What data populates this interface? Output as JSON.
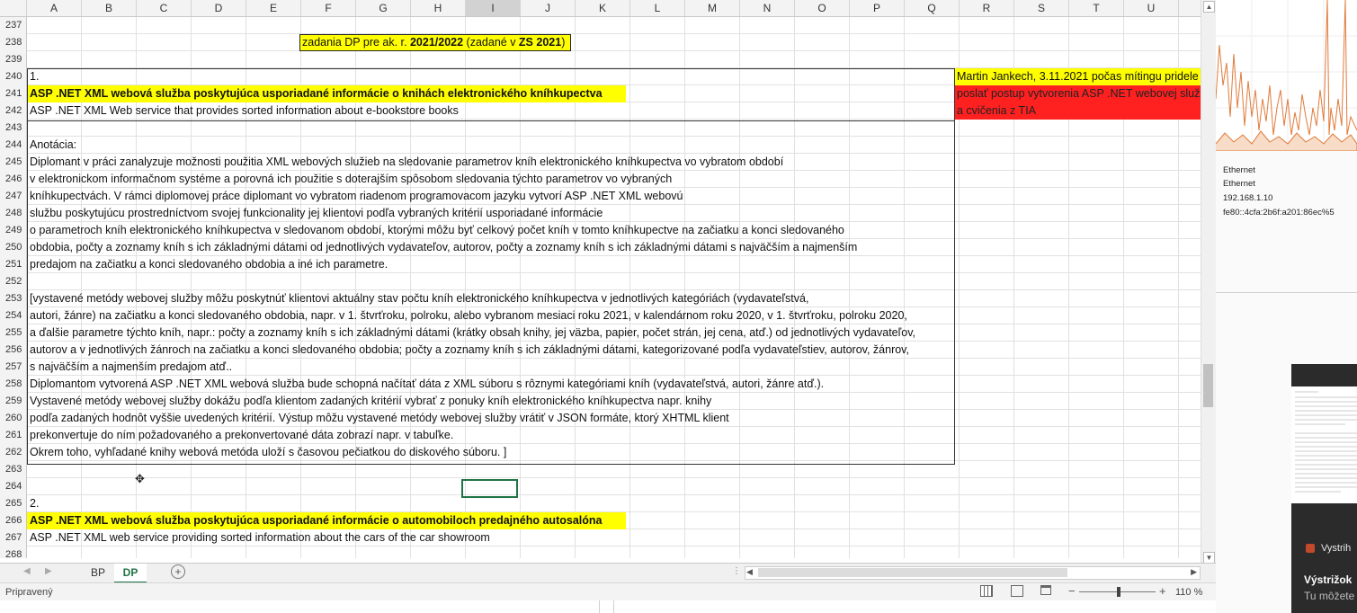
{
  "columns": [
    "A",
    "B",
    "C",
    "D",
    "E",
    "F",
    "G",
    "H",
    "I",
    "J",
    "K",
    "L",
    "M",
    "N",
    "O",
    "P",
    "Q",
    "R",
    "S",
    "T",
    "U"
  ],
  "rows": [
    {
      "num": "237",
      "text": "",
      "bold": false,
      "hl": false
    },
    {
      "num": "238",
      "text": "",
      "bold": false,
      "hl": false
    },
    {
      "num": "239",
      "text": "",
      "bold": false,
      "hl": false
    },
    {
      "num": "240",
      "text": "1.",
      "bold": false,
      "hl": false
    },
    {
      "num": "241",
      "text": "ASP .NET XML webová služba poskytujúca usporiadané informácie o knihách elektronického kníhkupectva",
      "bold": true,
      "hl": true
    },
    {
      "num": "242",
      "text": "ASP .NET XML Web service that provides sorted information about e-bookstore books",
      "bold": false,
      "hl": false
    },
    {
      "num": "243",
      "text": "",
      "bold": false,
      "hl": false
    },
    {
      "num": "244",
      "text": "Anotácia:",
      "bold": false,
      "hl": false
    },
    {
      "num": "245",
      "text": "Diplomant v práci zanalyzuje možnosti použitia XML webových služieb na sledovanie parametrov kníh elektronického kníhkupectva vo vybratom období",
      "bold": false,
      "hl": false
    },
    {
      "num": "246",
      "text": "v elektronickom informačnom systéme a porovná ich použitie s doterajším spôsobom sledovania týchto parametrov vo vybraných",
      "bold": false,
      "hl": false
    },
    {
      "num": "247",
      "text": "kníhkupectvách. V rámci diplomovej práce diplomant vo vybratom riadenom programovacom jazyku vytvorí ASP .NET XML webovú",
      "bold": false,
      "hl": false
    },
    {
      "num": "248",
      "text": "službu poskytujúcu prostredníctvom svojej funkcionality jej klientovi podľa vybraných kritérií usporiadané informácie",
      "bold": false,
      "hl": false
    },
    {
      "num": "249",
      "text": "o parametroch kníh elektronického kníhkupectva v sledovanom období, ktorými môžu byť celkový počet kníh v tomto kníhkupectve na začiatku a konci sledovaného",
      "bold": false,
      "hl": false
    },
    {
      "num": "250",
      "text": "obdobia, počty a zoznamy kníh s ich základnými dátami od jednotlivých vydavateľov, autorov, počty a zoznamy kníh s ich základnými dátami s najväčším a najmenším",
      "bold": false,
      "hl": false
    },
    {
      "num": "251",
      "text": "predajom na začiatku a konci sledovaného obdobia a iné ich parametre.",
      "bold": false,
      "hl": false
    },
    {
      "num": "252",
      "text": "",
      "bold": false,
      "hl": false
    },
    {
      "num": "253",
      "text": "[vystavené metódy webovej služby môžu poskytnúť klientovi aktuálny stav počtu kníh elektronického kníhkupectva v jednotlivých kategóriách (vydavateľstvá,",
      "bold": false,
      "hl": false
    },
    {
      "num": "254",
      "text": "autori, žánre) na začiatku a konci sledovaného obdobia, napr. v 1. štvrťroku, polroku, alebo vybranom mesiaci roku 2021, v kalendárnom roku 2020, v 1. štvrťroku, polroku 2020,",
      "bold": false,
      "hl": false
    },
    {
      "num": "255",
      "text": "a ďalšie parametre týchto kníh, napr.: počty a zoznamy kníh s ich základnými dátami (krátky obsah knihy, jej väzba, papier, počet strán, jej cena, atď.) od jednotlivých vydavateľov,",
      "bold": false,
      "hl": false
    },
    {
      "num": "256",
      "text": "autorov a v jednotlivých žánroch na začiatku a konci sledovaného obdobia; počty a zoznamy kníh  s ich základnými dátami, kategorizované podľa vydavateľstiev, autorov, žánrov,",
      "bold": false,
      "hl": false
    },
    {
      "num": "257",
      "text": " s najväčším a najmenším predajom atď..",
      "bold": false,
      "hl": false
    },
    {
      "num": "258",
      "text": "Diplomantom vytvorená ASP .NET XML webová služba bude schopná načítať dáta z XML súboru s rôznymi kategóriami kníh (vydavateľstvá, autori, žánre atď.).",
      "bold": false,
      "hl": false
    },
    {
      "num": "259",
      "text": " Vystavené metódy webovej služby dokážu podľa klientom zadaných kritérií vybrať z ponuky kníh elektronického kníhkupectva napr. knihy",
      "bold": false,
      "hl": false
    },
    {
      "num": "260",
      "text": " podľa zadaných hodnôt vyššie uvedených kritérií. Výstup môžu vystavené metódy webovej služby vrátiť v JSON formáte, ktorý XHTML klient",
      "bold": false,
      "hl": false
    },
    {
      "num": "261",
      "text": " prekonvertuje do ním požadovaného a prekonvertované dáta zobrazí napr. v tabuľke.",
      "bold": false,
      "hl": false
    },
    {
      "num": "262",
      "text": " Okrem toho, vyhľadané knihy webová metóda uloží s časovou pečiatkou do diskového súboru. ]",
      "bold": false,
      "hl": false
    },
    {
      "num": "263",
      "text": "",
      "bold": false,
      "hl": false
    },
    {
      "num": "264",
      "text": "",
      "bold": false,
      "hl": false
    },
    {
      "num": "265",
      "text": "2.",
      "bold": false,
      "hl": false
    },
    {
      "num": "266",
      "text": "ASP .NET XML webová služba poskytujúca usporiadané informácie o automobiloch predajného autosalóna",
      "bold": true,
      "hl": true
    },
    {
      "num": "267",
      "text": "ASP .NET XML web service providing sorted information about the cars of the car showroom",
      "bold": false,
      "hl": false
    },
    {
      "num": "268",
      "text": "",
      "bold": false,
      "hl": false
    }
  ],
  "header_cell": {
    "pre": "zadania DP pre ak. r. ",
    "year": "2021/2022",
    "mid": " (zadané v ",
    "term": "ZS 2021",
    "post": ")"
  },
  "side_note": {
    "line1": "Martin Jankech, 3.11.2021 počas mítingu pridele",
    "line2": "poslať postup vytvorenia ASP .NET webovej služb",
    "line3": "a cvičenia z TIA"
  },
  "sheet_tabs": [
    "BP",
    "DP"
  ],
  "active_tab": "DP",
  "status": {
    "ready": "Pripravený",
    "zoom": "110 %"
  },
  "network": {
    "l1": "Ethernet",
    "l2": "Ethernet",
    "l3": "192.168.1.10",
    "l4": "fe80::4cfa:2b6f:a201:86ec%5"
  },
  "snip": {
    "app": "Vystrih",
    "title": "Výstrižok",
    "desc": "Tu môžete"
  },
  "colors": {
    "excel_green": "#217346",
    "highlight_yellow": "#ffff00",
    "note_red": "#ff2020",
    "chart_line": "#e07a3a"
  }
}
